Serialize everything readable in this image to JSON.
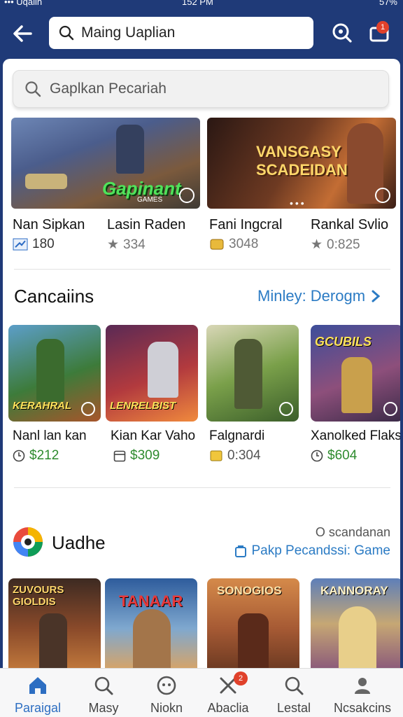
{
  "status_bar": {
    "left": "••• Uqalin",
    "time": "152 PM",
    "battery": "57%"
  },
  "header": {
    "search_text": "Maing Uaplian",
    "cart_badge": "1"
  },
  "search": {
    "placeholder": "Gaplkan Pecariah"
  },
  "featured": [
    {
      "banner_title": "Gapinant",
      "banner_sub": "GAMES"
    },
    {
      "banner_title": "VANSGASY SCADEIDAN"
    }
  ],
  "featured_games": [
    {
      "name": "Nan Sipkan",
      "meta": "180",
      "icon": "chart-icon"
    },
    {
      "name": "Lasin Raden",
      "meta": "334",
      "icon": "star-icon"
    },
    {
      "name": "Fani Ingcral",
      "meta": "3048",
      "icon": "coin-icon"
    },
    {
      "name": "Rankal Svlio",
      "meta": "0:825",
      "icon": "star-icon"
    }
  ],
  "section1": {
    "title": "Cancaiins",
    "link": "Minley: Derogm",
    "tiles": [
      {
        "title": "KERAHRAL",
        "name": "Nanl lan kan",
        "meta": "$212",
        "icon": "clock-icon",
        "price": true
      },
      {
        "title": "LENRELBIST",
        "name": "Kian Kar Vaho",
        "meta": "$309",
        "icon": "calendar-icon",
        "price": true
      },
      {
        "title": "",
        "name": "Falgnardi",
        "meta": "0:304",
        "icon": "coin-icon",
        "price": false
      },
      {
        "title": "GCUBILS",
        "name": "Xanolked Flaks",
        "meta": "$604",
        "icon": "clock-icon",
        "price": true
      }
    ]
  },
  "section2": {
    "title": "Uadhe",
    "subtitle": "O scandanan",
    "link": "Pakp Pecandssi: Game",
    "tiles": [
      {
        "title": "ZUVOURS GIOLDIS"
      },
      {
        "title": "TANAAR"
      },
      {
        "title": "SONOGIOS"
      },
      {
        "title": "KANNORAY"
      }
    ]
  },
  "bottom_nav": [
    {
      "label": "Paraigal",
      "icon": "home-icon",
      "active": true
    },
    {
      "label": "Masy",
      "icon": "search-icon",
      "active": false
    },
    {
      "label": "Niokn",
      "icon": "gamepad-icon",
      "active": false
    },
    {
      "label": "Abaclia",
      "icon": "tools-icon",
      "active": false,
      "badge": "2"
    },
    {
      "label": "Lestal",
      "icon": "search-icon",
      "active": false
    },
    {
      "label": "Ncsakcins",
      "icon": "profile-icon",
      "active": false
    }
  ],
  "colors": {
    "header_bg": "#1f3a78",
    "link": "#2b7bc4",
    "active_nav": "#2d6ec2",
    "price_green": "#2e8b2e",
    "badge": "#e0412b"
  }
}
